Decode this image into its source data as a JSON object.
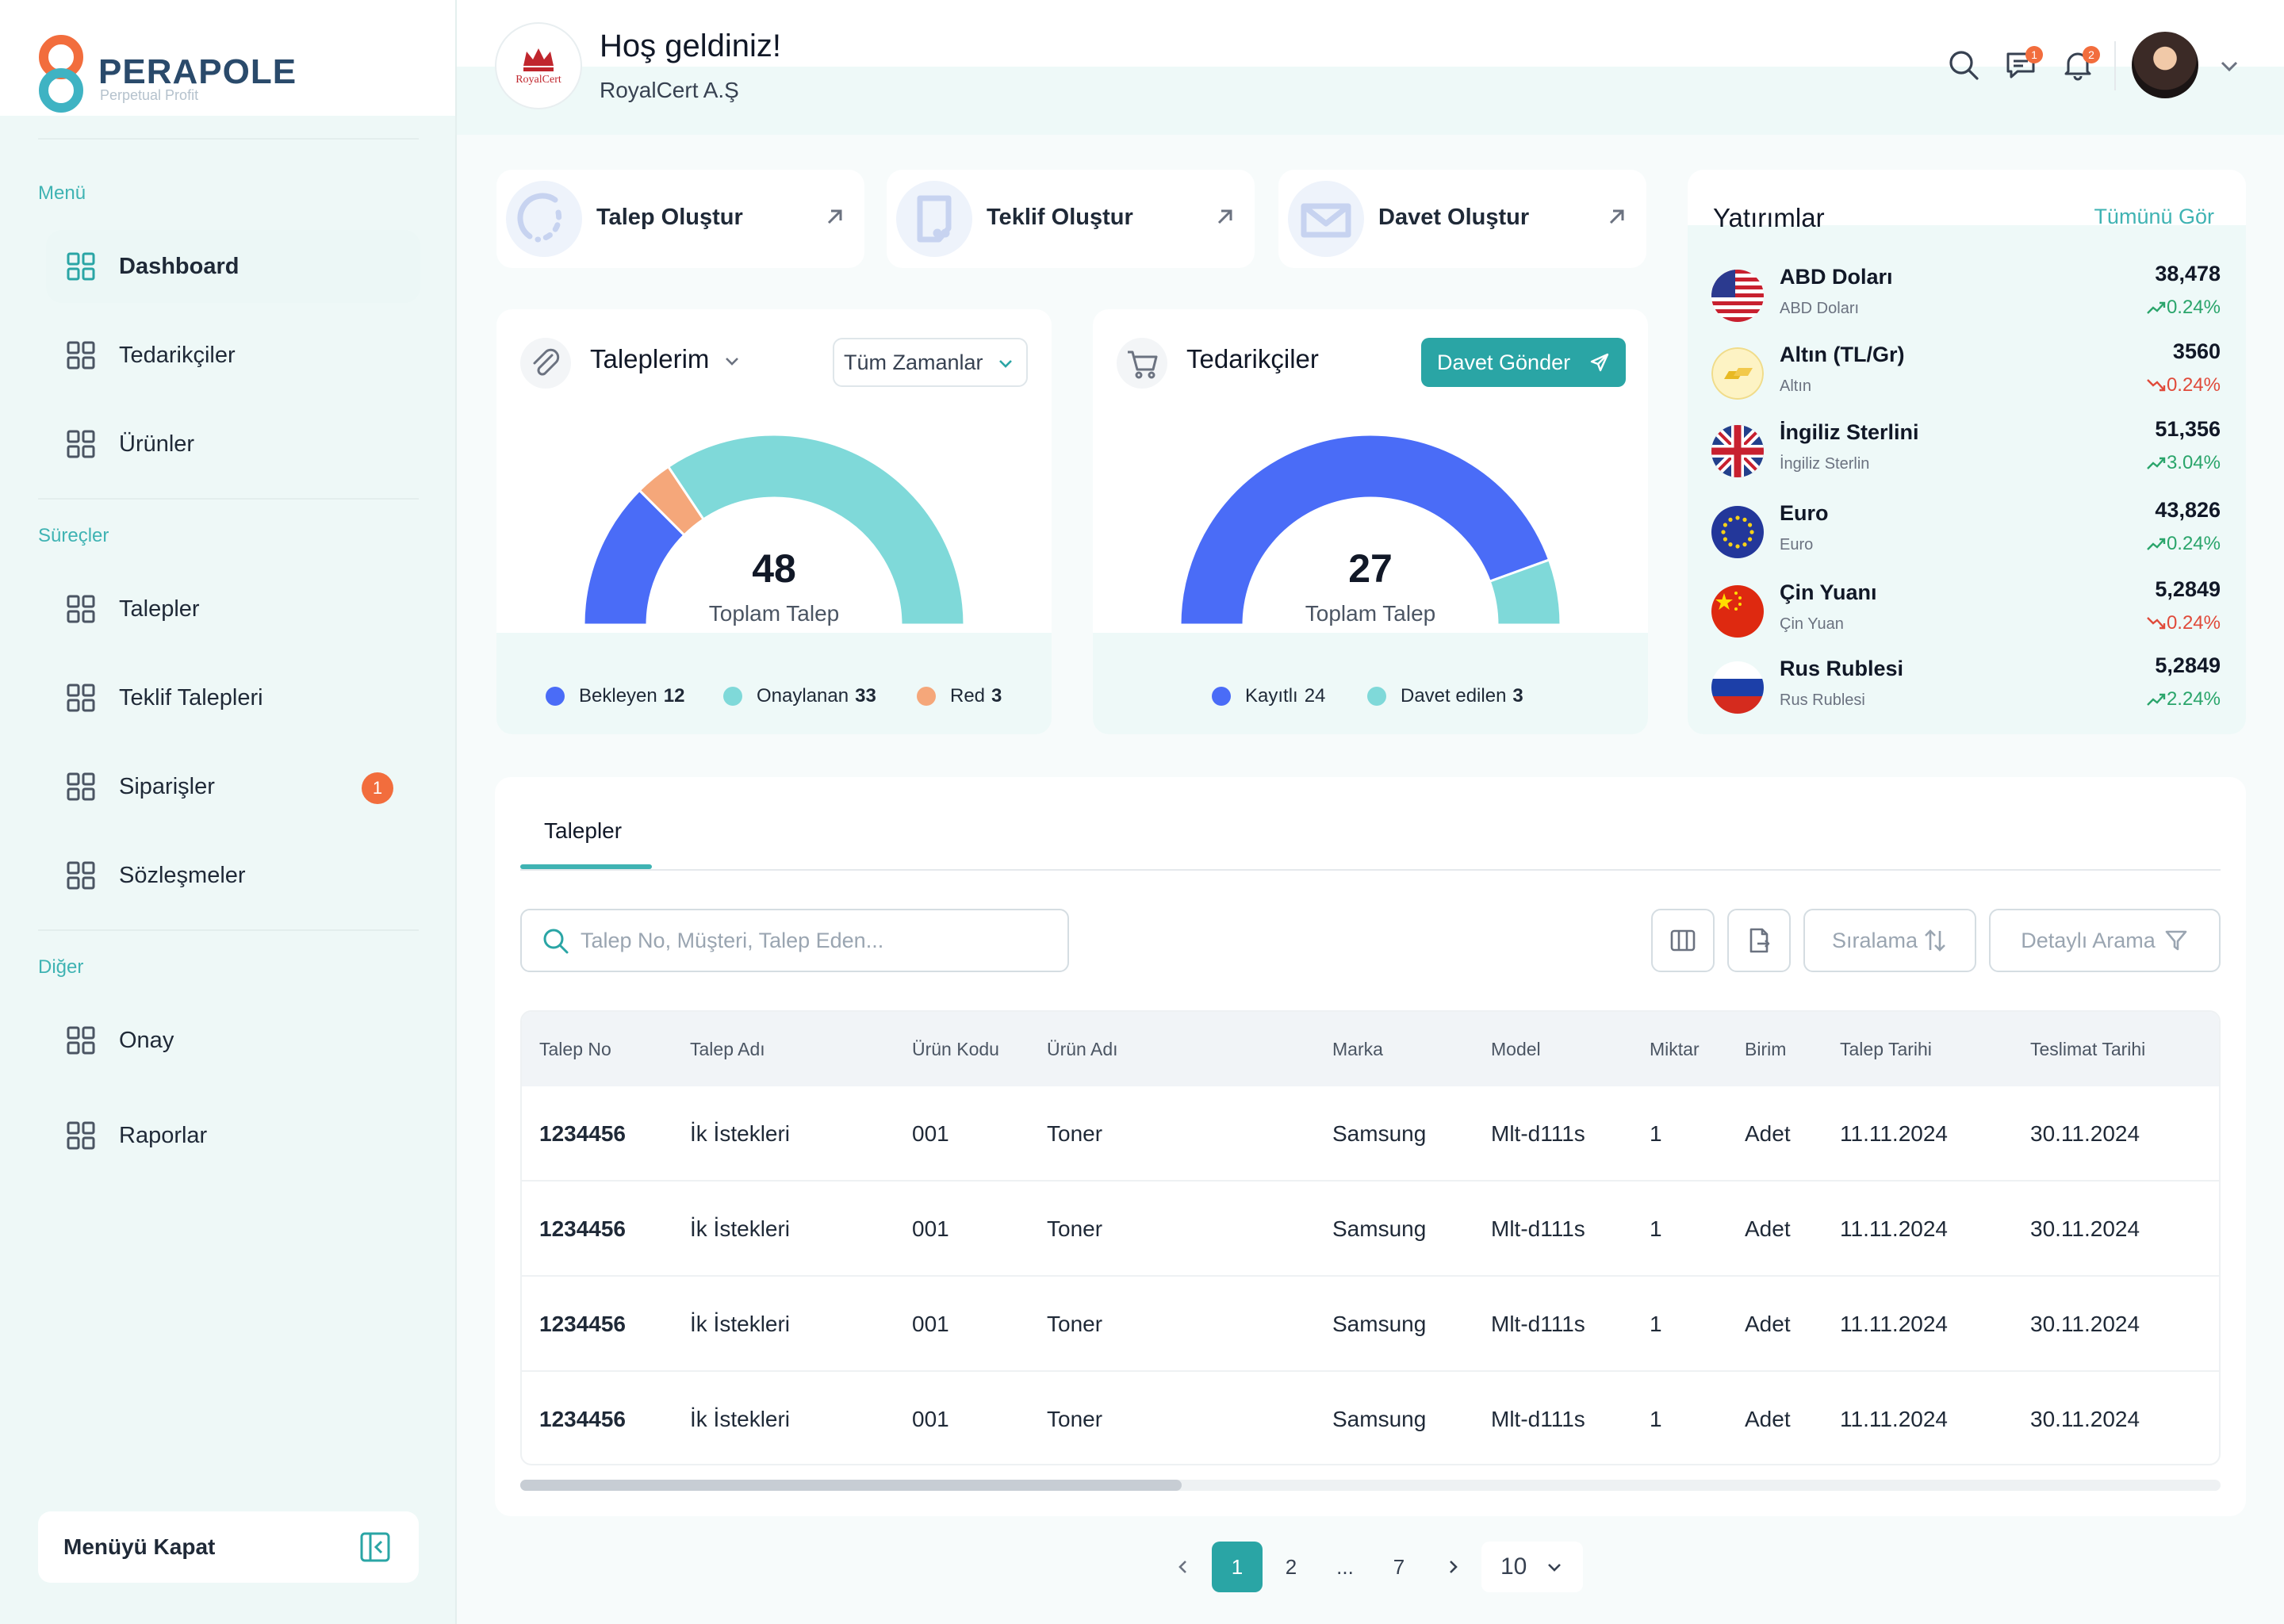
{
  "brand": {
    "name": "PERAPOLE",
    "tagline": "Perpetual Profit"
  },
  "sidebar": {
    "sections": [
      {
        "title": "Menü",
        "items": [
          {
            "label": "Dashboard",
            "active": true
          },
          {
            "label": "Tedarikçiler"
          },
          {
            "label": "Ürünler"
          }
        ]
      },
      {
        "title": "Süreçler",
        "items": [
          {
            "label": "Talepler"
          },
          {
            "label": "Teklif Talepleri"
          },
          {
            "label": "Siparişler",
            "badge": "1"
          },
          {
            "label": "Sözleşmeler"
          }
        ]
      },
      {
        "title": "Diğer",
        "items": [
          {
            "label": "Onay"
          },
          {
            "label": "Raporlar"
          }
        ]
      }
    ],
    "collapse_label": "Menüyü Kapat"
  },
  "header": {
    "welcome": "Hoş geldiniz!",
    "company": "RoyalCert A.Ş",
    "company_logo_text": "RoyalCert",
    "messages_badge": "1",
    "notifications_badge": "2"
  },
  "quick_actions": [
    {
      "label": "Talep Oluştur"
    },
    {
      "label": "Teklif Oluştur"
    },
    {
      "label": "Davet Oluştur"
    }
  ],
  "requests_widget": {
    "title": "Taleplerim",
    "filter": "Tüm Zamanlar",
    "total": "48",
    "total_label": "Toplam Talep",
    "legend": [
      {
        "label": "Bekleyen",
        "value": "12",
        "color": "#4a6cf7"
      },
      {
        "label": "Onaylanan",
        "value": "33",
        "color": "#7fd9d9"
      },
      {
        "label": "Red",
        "value": "3",
        "color": "#f5a77a"
      }
    ]
  },
  "suppliers_widget": {
    "title": "Tedarikçiler",
    "button": "Davet Gönder",
    "total": "27",
    "total_label": "Toplam Talep",
    "legend": [
      {
        "label": "Kayıtlı",
        "value": "24",
        "color": "#4a6cf7"
      },
      {
        "label": "Davet edilen",
        "value": "3",
        "color": "#7fd9d9"
      }
    ]
  },
  "chart_data": [
    {
      "type": "pie",
      "title": "Taleplerim",
      "categories": [
        "Bekleyen",
        "Onaylanan",
        "Red"
      ],
      "values": [
        12,
        33,
        3
      ]
    },
    {
      "type": "pie",
      "title": "Tedarikçiler",
      "categories": [
        "Kayıtlı",
        "Davet edilen"
      ],
      "values": [
        24,
        3
      ]
    }
  ],
  "investments": {
    "title": "Yatırımlar",
    "view_all": "Tümünü Gör",
    "items": [
      {
        "name": "ABD Doları",
        "sub": "ABD Doları",
        "value": "38,478",
        "change": "0.24%",
        "dir": "up",
        "flag": "us-flag-icon"
      },
      {
        "name": "Altın (TL/Gr)",
        "sub": "Altın",
        "value": "3560",
        "change": "0.24%",
        "dir": "down",
        "flag": "gold-icon"
      },
      {
        "name": "İngiliz Sterlini",
        "sub": "İngiliz Sterlin",
        "value": "51,356",
        "change": "3.04%",
        "dir": "up",
        "flag": "uk-flag-icon"
      },
      {
        "name": "Euro",
        "sub": "Euro",
        "value": "43,826",
        "change": "0.24%",
        "dir": "up",
        "flag": "eu-flag-icon"
      },
      {
        "name": "Çin Yuanı",
        "sub": "Çin Yuan",
        "value": "5,2849",
        "change": "0.24%",
        "dir": "down",
        "flag": "cn-flag-icon"
      },
      {
        "name": "Rus Rublesi",
        "sub": "Rus Rublesi",
        "value": "5,2849",
        "change": "2.24%",
        "dir": "up",
        "flag": "ru-flag-icon"
      }
    ]
  },
  "table": {
    "tab": "Talepler",
    "search_placeholder": "Talep No, Müşteri, Talep Eden...",
    "sort_label": "Sıralama",
    "filter_label": "Detaylı Arama",
    "columns": [
      "Talep No",
      "Talep Adı",
      "Ürün Kodu",
      "Ürün Adı",
      "Marka",
      "Model",
      "Miktar",
      "Birim",
      "Talep Tarihi",
      "Teslimat Tarihi"
    ],
    "rows": [
      [
        "1234456",
        "İk İstekleri",
        "001",
        "Toner",
        "Samsung",
        "Mlt-d111s",
        "1",
        "Adet",
        "11.11.2024",
        "30.11.2024"
      ],
      [
        "1234456",
        "İk İstekleri",
        "001",
        "Toner",
        "Samsung",
        "Mlt-d111s",
        "1",
        "Adet",
        "11.11.2024",
        "30.11.2024"
      ],
      [
        "1234456",
        "İk İstekleri",
        "001",
        "Toner",
        "Samsung",
        "Mlt-d111s",
        "1",
        "Adet",
        "11.11.2024",
        "30.11.2024"
      ],
      [
        "1234456",
        "İk İstekleri",
        "001",
        "Toner",
        "Samsung",
        "Mlt-d111s",
        "1",
        "Adet",
        "11.11.2024",
        "30.11.2024"
      ]
    ]
  },
  "pagination": {
    "pages": [
      "1",
      "2",
      "...",
      "7"
    ],
    "current": "1",
    "page_size": "10"
  }
}
